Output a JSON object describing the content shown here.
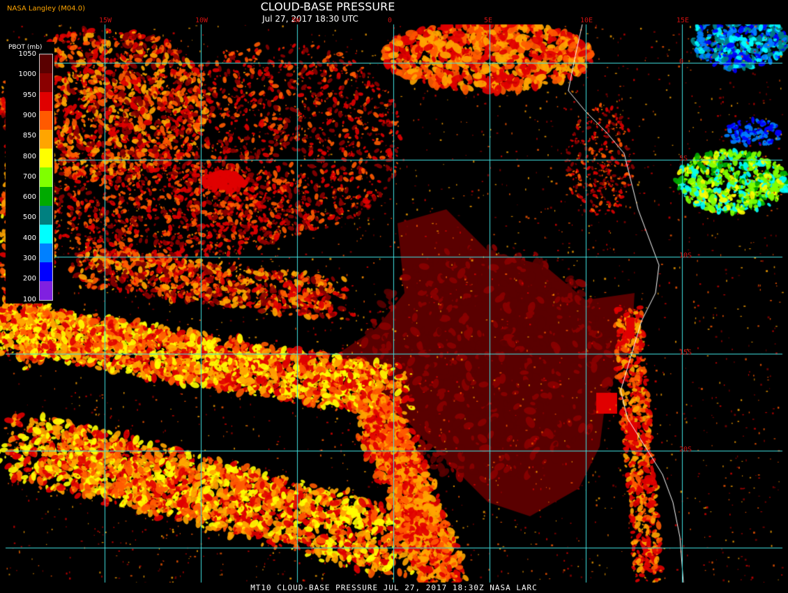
{
  "title": "CLOUD-BASE PRESSURE",
  "subtitle": "Jul 27, 2017 18:30 UTC",
  "producer": "NASA Langley (M04.0)",
  "footer": "MT10  CLOUD-BASE PRESSURE  JUL 27, 2017 18:30Z  NASA LARC",
  "legend": {
    "title": "PBOT (mb)",
    "levels": [
      "1050",
      "1000",
      "950",
      "900",
      "850",
      "800",
      "700",
      "600",
      "500",
      "400",
      "300",
      "200",
      "100"
    ],
    "colors": [
      "#5a0000",
      "#8a0000",
      "#e00000",
      "#ff5a00",
      "#ffa500",
      "#ffff00",
      "#80ff00",
      "#00aa00",
      "#008080",
      "#00ffff",
      "#0080ff",
      "#0000ff",
      "#8020e0"
    ]
  },
  "grid": {
    "longitudes": [
      "15W",
      "10W",
      "5W",
      "0",
      "5E",
      "10E",
      "15E"
    ],
    "latitudes": [
      "0",
      "5S",
      "10S",
      "15S",
      "20S"
    ],
    "line_color": "#40e0e0"
  },
  "coastline_color": "#ffffff",
  "background_color": "#000000"
}
